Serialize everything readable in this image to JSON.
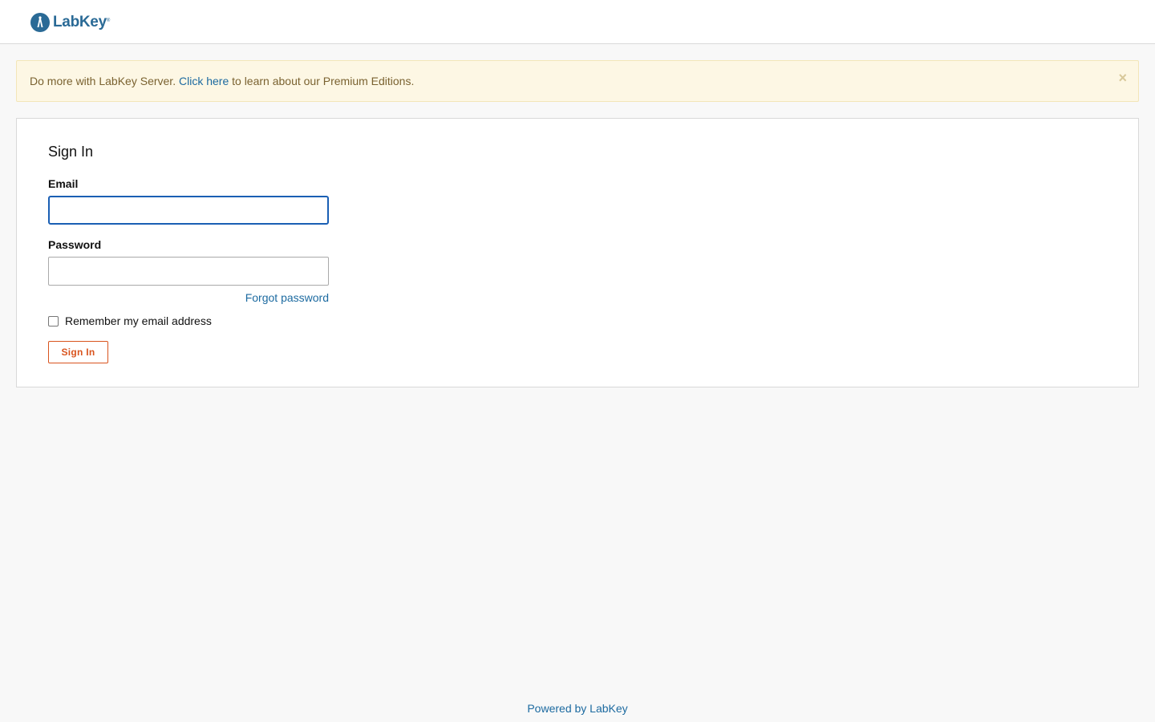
{
  "header": {
    "logo_text": "LabKey",
    "logo_reg": "®",
    "brand_color": "#2a6a96"
  },
  "banner": {
    "text_before": "Do more with LabKey Server. ",
    "link_text": "Click here",
    "text_after": " to learn about our Premium Editions.",
    "close_label": "×"
  },
  "signin": {
    "title": "Sign In",
    "email_label": "Email",
    "email_value": "",
    "password_label": "Password",
    "password_value": "",
    "forgot_label": "Forgot password",
    "remember_label": "Remember my email address",
    "remember_checked": false,
    "button_label": "Sign In",
    "button_color": "#d9541e"
  },
  "footer": {
    "text": "Powered by LabKey"
  }
}
